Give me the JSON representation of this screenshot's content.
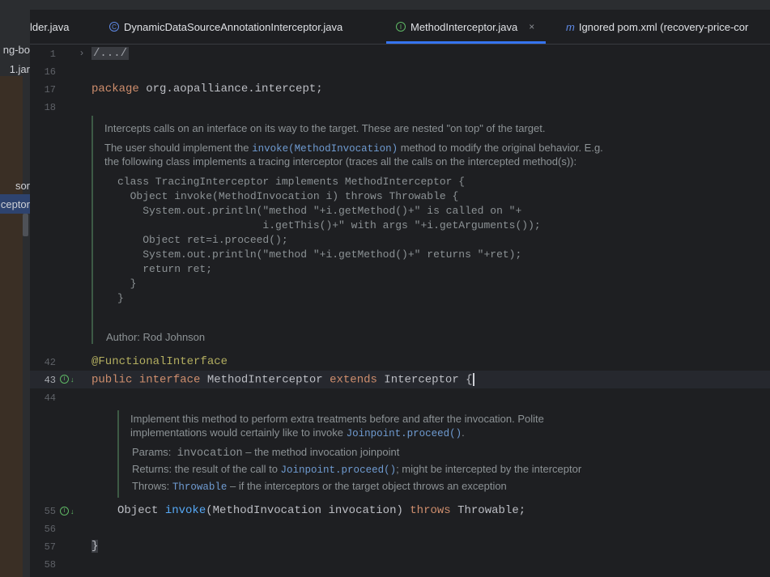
{
  "project_panel": {
    "items": [
      "ng-bo",
      "1.jar",
      "sor",
      "ceptor"
    ]
  },
  "tabs": [
    {
      "label": "lder.java",
      "icon": "none"
    },
    {
      "label": "DynamicDataSourceAnnotationInterceptor.java",
      "icon": "class-icon"
    },
    {
      "label": "MethodInterceptor.java",
      "icon": "interface-icon",
      "close": "×"
    },
    {
      "label": "Ignored pom.xml (recovery-price-cor",
      "icon": "maven-icon"
    }
  ],
  "line_numbers": {
    "l1": "1",
    "l16": "16",
    "l17": "17",
    "l18": "18",
    "l42": "42",
    "l43": "43",
    "l44": "44",
    "l55": "55",
    "l56": "56",
    "l57": "57",
    "l58": "58"
  },
  "code": {
    "fold_import": "/.../",
    "package_kw": "package",
    "package_name": " org.aopalliance.intercept;",
    "annotation": "@FunctionalInterface",
    "public_kw": "public",
    "interface_kw": "interface",
    "iface_name": " MethodInterceptor ",
    "extends_kw": "extends",
    "super_name": " Interceptor ",
    "brace_open": "{",
    "method_type": "Object ",
    "method_name": "invoke",
    "method_params": "(MethodInvocation invocation) ",
    "throws_kw": "throws",
    "throws_type": " Throwable;",
    "brace_close": "}"
  },
  "doc1": {
    "line1": "Intercepts calls on an interface on its way to the target. These are nested \"on top\" of the target.",
    "line2_pre": "The user should implement the ",
    "line2_code": "invoke(MethodInvocation)",
    "line2_post": " method to modify the original behavior. E.g.",
    "line3": "the following class implements a tracing interceptor (traces all the calls on the intercepted method(s)):",
    "example": "class TracingInterceptor implements MethodInterceptor {\n  Object invoke(MethodInvocation i) throws Throwable {\n    System.out.println(\"method \"+i.getMethod()+\" is called on \"+\n                       i.getThis()+\" with args \"+i.getArguments());\n    Object ret=i.proceed();\n    System.out.println(\"method \"+i.getMethod()+\" returns \"+ret);\n    return ret;\n  }\n}",
    "author": "Author: Rod Johnson"
  },
  "doc2": {
    "line1": "Implement this method to perform extra treatments before and after the invocation. Polite",
    "line2_pre": "implementations would certainly like to invoke ",
    "line2_code": "Joinpoint.proceed()",
    "line2_post": ".",
    "params_label": "Params:",
    "params_code": "invocation",
    "params_text": " – the method invocation joinpoint",
    "returns_label": "Returns:",
    "returns_pre": " the result of the call to ",
    "returns_code": "Joinpoint.proceed()",
    "returns_post": "; might be intercepted by the interceptor",
    "throws_label": "Throws:",
    "throws_code": "Throwable",
    "throws_text": " – if the interceptors or the target object throws an exception"
  },
  "colors": {
    "keyword": "#cf8e6d",
    "method": "#56a8f5",
    "annotation": "#b3ae60",
    "accent": "#3574f0"
  }
}
